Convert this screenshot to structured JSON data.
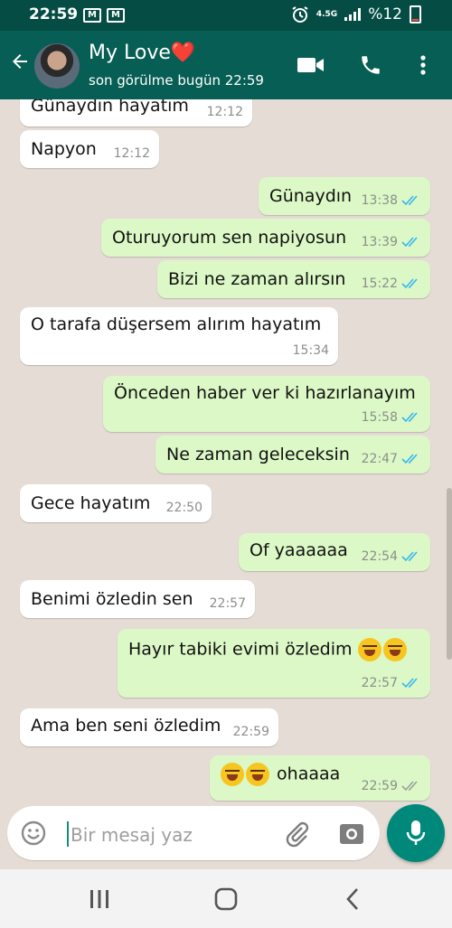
{
  "statusbar": {
    "time": "22:59",
    "network": "4.5G",
    "battery": "%12"
  },
  "header": {
    "contact_name": "My Love❤️",
    "last_seen": "son görülme bugün 22:59"
  },
  "messages": [
    {
      "dir": "in",
      "text": "Günaydın hayatım",
      "time": "12:12"
    },
    {
      "dir": "in",
      "text": "Napyon",
      "time": "12:12"
    },
    {
      "dir": "out",
      "text": "Günaydın",
      "time": "13:38",
      "status": "read"
    },
    {
      "dir": "out",
      "text": "Oturuyorum sen napiyosun",
      "time": "13:39",
      "status": "read"
    },
    {
      "dir": "out",
      "text": "Bizi ne zaman alırsın",
      "time": "15:22",
      "status": "read"
    },
    {
      "dir": "in",
      "text": "O tarafa düşersem alırım hayatım",
      "time": "15:34"
    },
    {
      "dir": "out",
      "text": "Önceden haber ver ki hazırlanayım",
      "time": "15:58",
      "status": "read"
    },
    {
      "dir": "out",
      "text": "Ne zaman geleceksin",
      "time": "22:47",
      "status": "read"
    },
    {
      "dir": "in",
      "text": "Gece hayatım",
      "time": "22:50"
    },
    {
      "dir": "out",
      "text": "Of yaaaaaa",
      "time": "22:54",
      "status": "read"
    },
    {
      "dir": "in",
      "text": "Benimi özledin sen",
      "time": "22:57"
    },
    {
      "dir": "out",
      "text": "Hayır tabiki evimi özledim",
      "time": "22:57",
      "status": "read",
      "emoji": "rofl-emoji x2"
    },
    {
      "dir": "in",
      "text": "Ama ben seni özledim",
      "time": "22:59"
    },
    {
      "dir": "out",
      "text": "ohaaaa",
      "time": "22:59",
      "status": "delivered",
      "emoji": "rofl-emoji x2"
    }
  ],
  "input": {
    "placeholder": "Bir mesaj yaz"
  },
  "colors": {
    "header": "#075e54",
    "outgoing_bubble": "#dcf8c6",
    "incoming_bubble": "#ffffff",
    "read_tick": "#34b7f1",
    "fab": "#00897b"
  }
}
